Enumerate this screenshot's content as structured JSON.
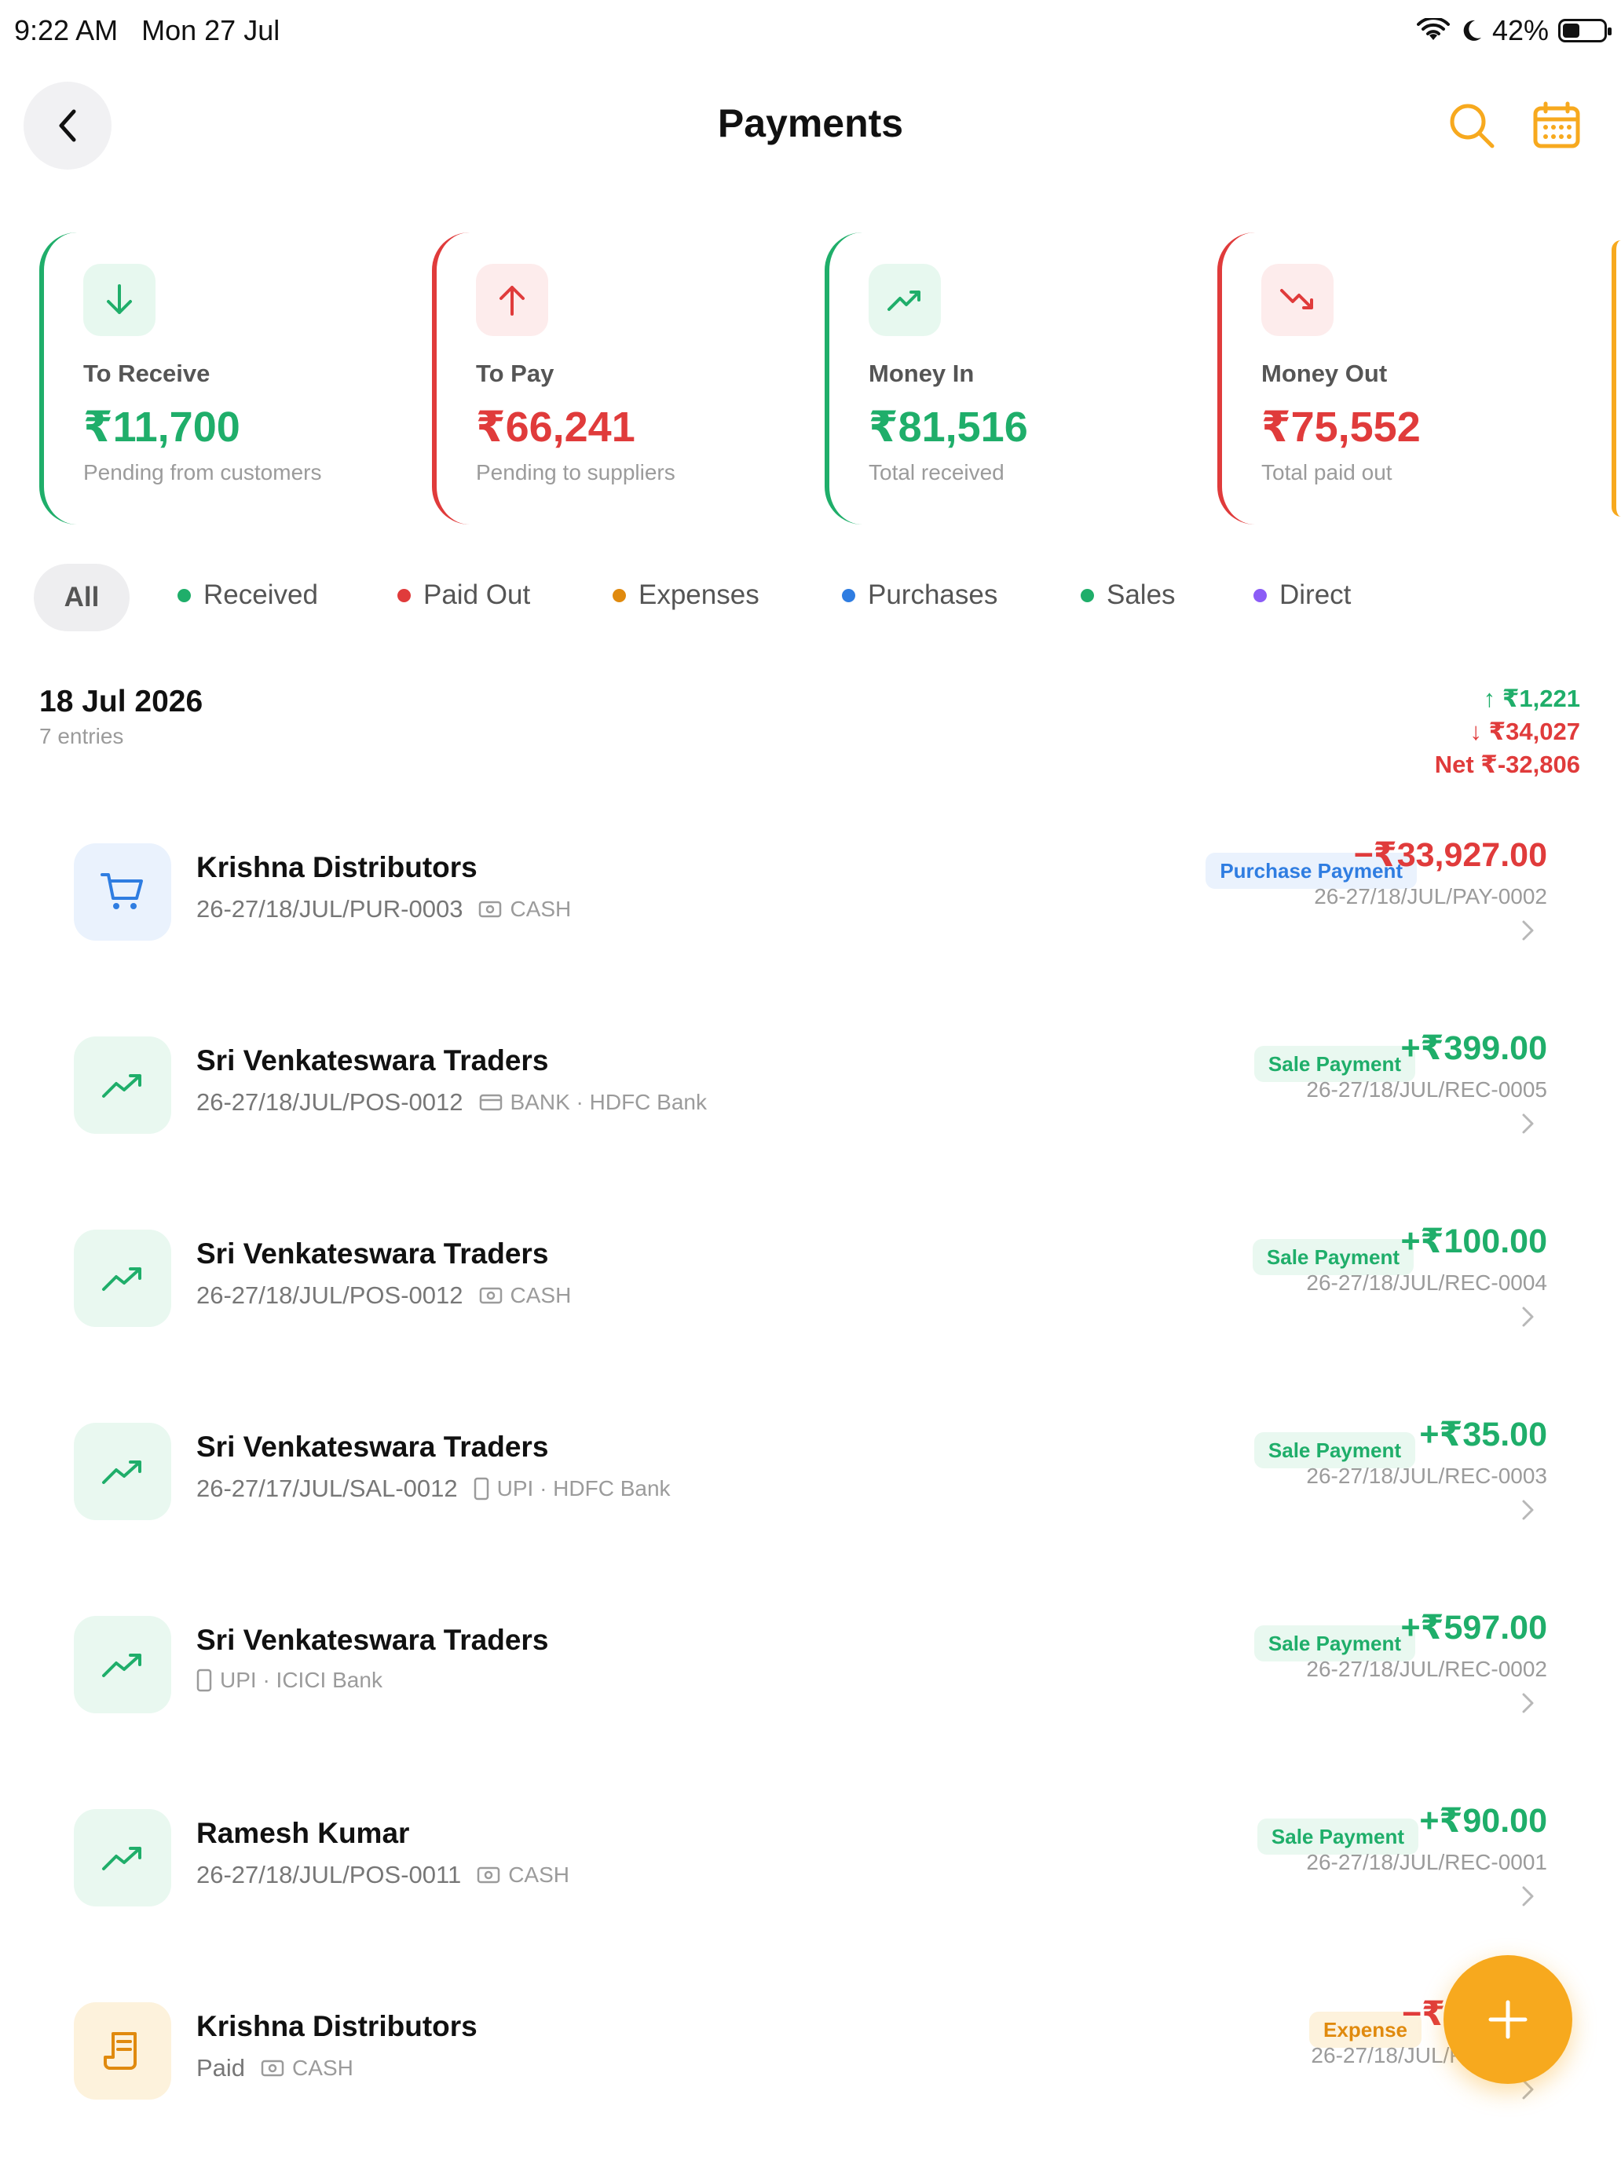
{
  "status": {
    "time": "9:22 AM",
    "date": "Mon 27 Jul",
    "battery": "42%",
    "battery_level": 0.42
  },
  "header": {
    "title": "Payments"
  },
  "colors": {
    "accent": "#f7a91e",
    "green": "#1fae6a",
    "red": "#e03b3b",
    "blue": "#2f7de1",
    "orange": "#e08a0e",
    "purple": "#8b5cf6"
  },
  "cards": [
    {
      "label": "To Receive",
      "value": "₹11,700",
      "sub": "Pending from customers",
      "icon": "arrow-down-icon"
    },
    {
      "label": "To Pay",
      "value": "₹66,241",
      "sub": "Pending to suppliers",
      "icon": "arrow-up-icon"
    },
    {
      "label": "Money In",
      "value": "₹81,516",
      "sub": "Total received",
      "icon": "trend-up-icon"
    },
    {
      "label": "Money Out",
      "value": "₹75,552",
      "sub": "Total paid out",
      "icon": "trend-down-icon"
    }
  ],
  "filters": {
    "all": "All",
    "items": [
      "Received",
      "Paid Out",
      "Expenses",
      "Purchases",
      "Sales",
      "Direct"
    ]
  },
  "group": {
    "date": "18 Jul 2026",
    "entries": "7 entries",
    "in": "↑ ₹1,221",
    "out": "↓ ₹34,027",
    "net": "Net ₹-32,806"
  },
  "rows": [
    {
      "name": "Krishna Distributors",
      "doc": "26-27/18/JUL/PUR-0003",
      "method": "CASH",
      "badge": "Purchase Payment",
      "amount": "−₹33,927.00",
      "ref": "26-27/18/JUL/PAY-0002"
    },
    {
      "name": "Sri Venkateswara Traders",
      "doc": "26-27/18/JUL/POS-0012",
      "method": "BANK · HDFC Bank",
      "badge": "Sale Payment",
      "amount": "+₹399.00",
      "ref": "26-27/18/JUL/REC-0005"
    },
    {
      "name": "Sri Venkateswara Traders",
      "doc": "26-27/18/JUL/POS-0012",
      "method": "CASH",
      "badge": "Sale Payment",
      "amount": "+₹100.00",
      "ref": "26-27/18/JUL/REC-0004"
    },
    {
      "name": "Sri Venkateswara Traders",
      "doc": "26-27/17/JUL/SAL-0012",
      "method": "UPI · HDFC Bank",
      "badge": "Sale Payment",
      "amount": "+₹35.00",
      "ref": "26-27/18/JUL/REC-0003"
    },
    {
      "name": "Sri Venkateswara Traders",
      "doc": "",
      "method": "UPI · ICICI Bank",
      "badge": "Sale Payment",
      "amount": "+₹597.00",
      "ref": "26-27/18/JUL/REC-0002"
    },
    {
      "name": "Ramesh Kumar",
      "doc": "26-27/18/JUL/POS-0011",
      "method": "CASH",
      "badge": "Sale Payment",
      "amount": "+₹90.00",
      "ref": "26-27/18/JUL/REC-0001"
    },
    {
      "name": "Krishna Distributors",
      "doc": "Paid",
      "method": "CASH",
      "badge": "Expense",
      "amount": "−₹1",
      "ref": "26-27/18/JUL/P"
    }
  ]
}
